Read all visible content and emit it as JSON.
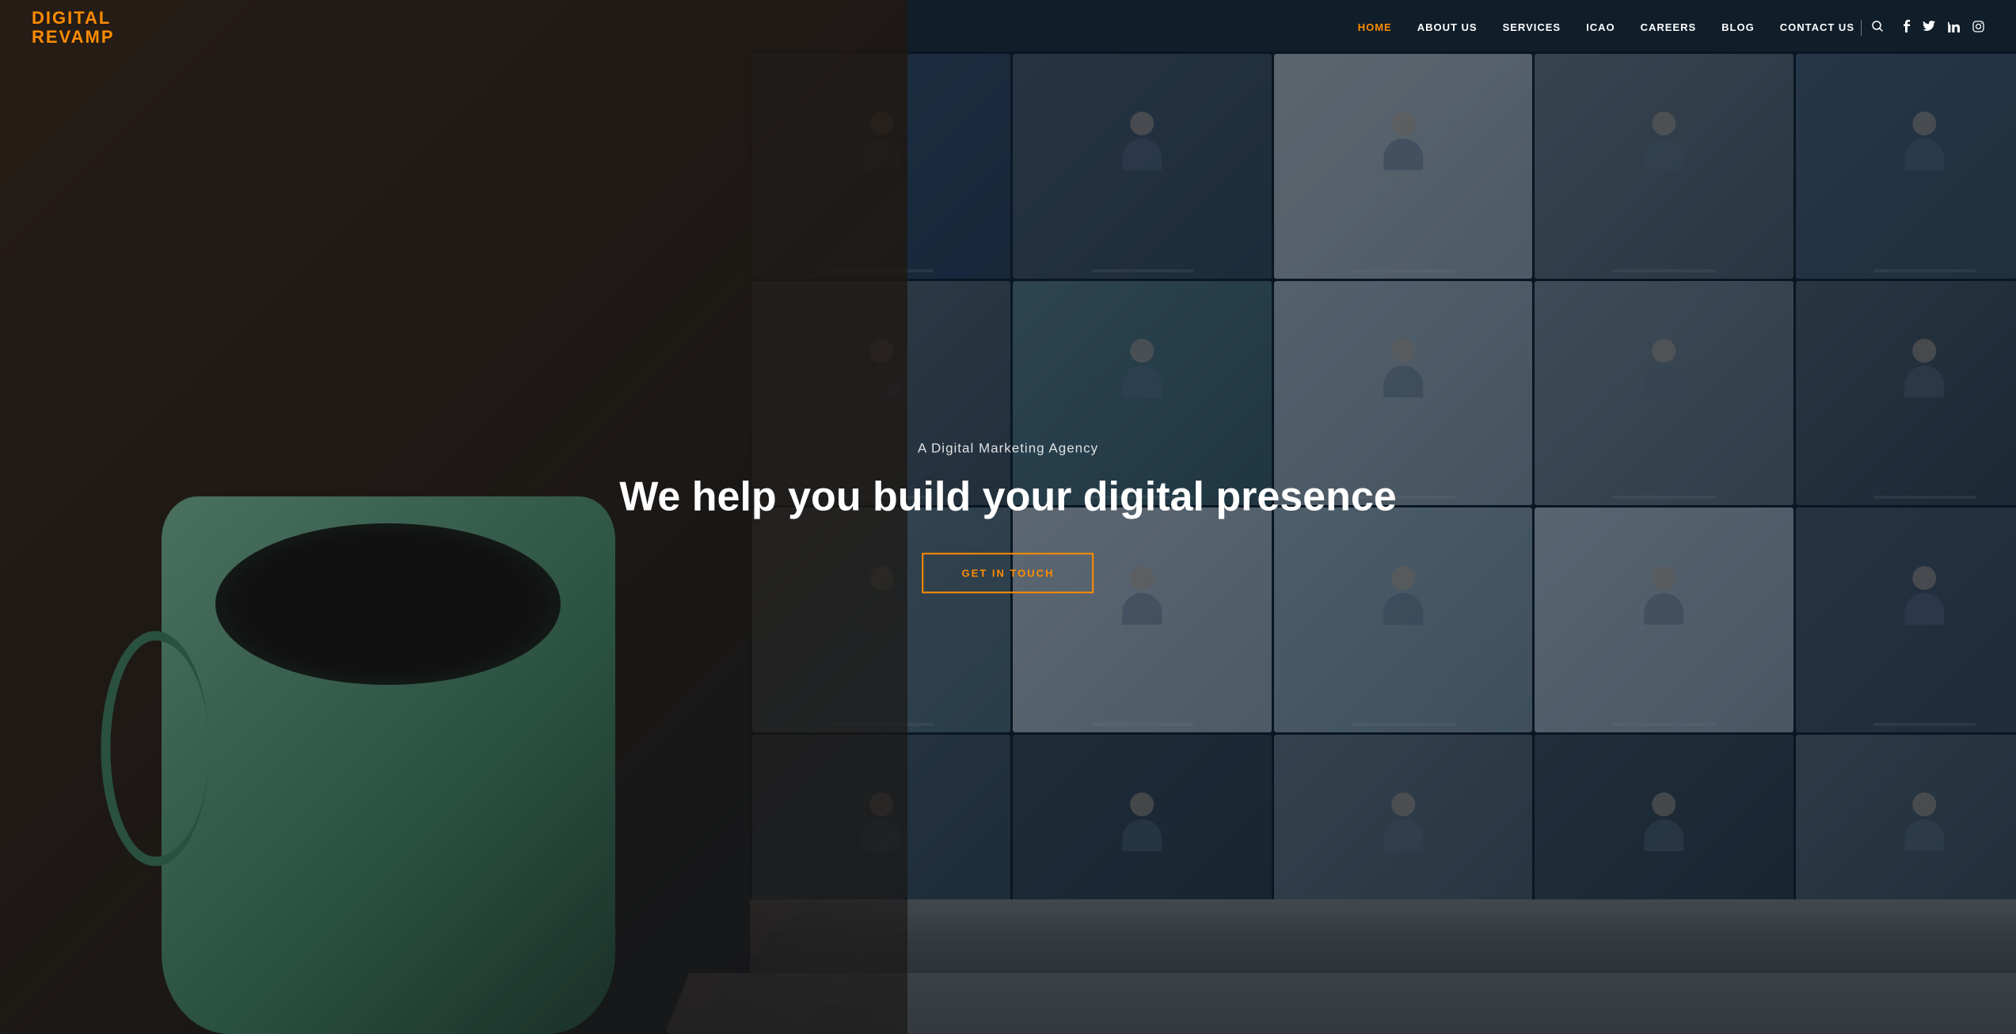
{
  "logo": {
    "line1": "DIGITAL",
    "line2": "REVAMP"
  },
  "nav": {
    "links": [
      {
        "label": "HOME",
        "active": true
      },
      {
        "label": "ABOUT US",
        "active": false
      },
      {
        "label": "SERVICES",
        "active": false
      },
      {
        "label": "ICAO",
        "active": false
      },
      {
        "label": "CAREERS",
        "active": false
      },
      {
        "label": "BLOG",
        "active": false
      },
      {
        "label": "CONTACT US",
        "active": false
      }
    ],
    "search_label": "search",
    "social": [
      {
        "name": "facebook",
        "icon": "f"
      },
      {
        "name": "twitter",
        "icon": "t"
      },
      {
        "name": "linkedin",
        "icon": "in"
      },
      {
        "name": "instagram",
        "icon": "ig"
      }
    ]
  },
  "hero": {
    "subtitle": "A Digital Marketing Agency",
    "title": "We help you build your digital presence",
    "cta_label": "GET IN TOUCH"
  },
  "colors": {
    "accent": "#ff8c00",
    "text_primary": "#ffffff",
    "nav_bg": "transparent"
  }
}
